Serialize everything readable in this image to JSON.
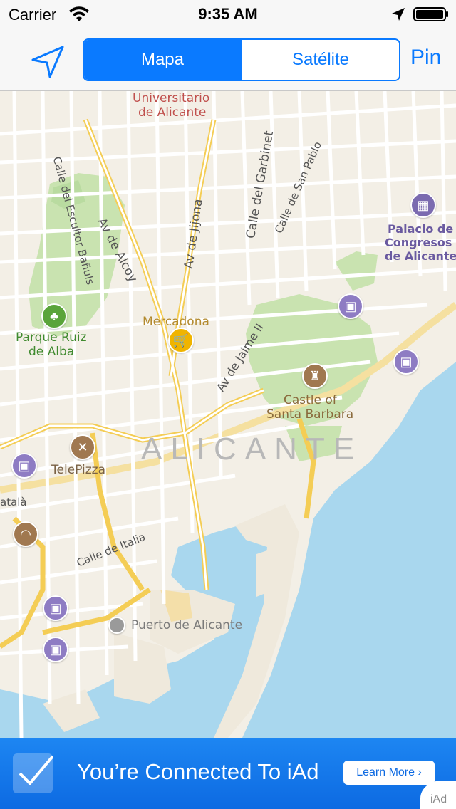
{
  "status_bar": {
    "carrier": "Carrier",
    "time": "9:35 AM"
  },
  "nav_bar": {
    "segments": [
      "Mapa",
      "Satélite"
    ],
    "selected_segment": "Mapa",
    "pin_label": "Pin",
    "accent_color": "#0a7aff"
  },
  "map": {
    "city_label": "ALICANTE",
    "street_labels": {
      "universitario": "Universitario",
      "universitario2": "de Alicante",
      "av_alcoy": "Av de Alcoy",
      "av_jijona": "Av de Jijona",
      "calle_garbinet": "Calle del Garbinet",
      "calle_san_pablo": "Calle de San Pablo",
      "calle_escultor": "Calle del Escultor Bañuls",
      "av_jaime": "Av de Jaime II",
      "calle_italia": "Calle de Italia",
      "catala": "atalà"
    },
    "pois": {
      "palacio1": "Palacio de",
      "palacio2": "Congresos",
      "palacio3": "de Alicante",
      "parque1": "Parque Ruiz",
      "parque2": "de Alba",
      "mercadona": "Mercadona",
      "castle1": "Castle of",
      "castle2": "Santa Barbara",
      "telepizza": "TelePizza",
      "puerto": "Puerto de Alicante"
    },
    "poi_icons": {
      "transit": "train-icon",
      "park": "tree-icon",
      "shopping": "cart-icon",
      "landmark": "castle-icon",
      "food": "fork-knife-icon",
      "congress": "auditorium-icon",
      "bakery": "bread-icon",
      "port": "dot-icon"
    }
  },
  "iad": {
    "message": "You’re Connected To iAd",
    "button": "Learn More ›",
    "brand": "iAd"
  }
}
